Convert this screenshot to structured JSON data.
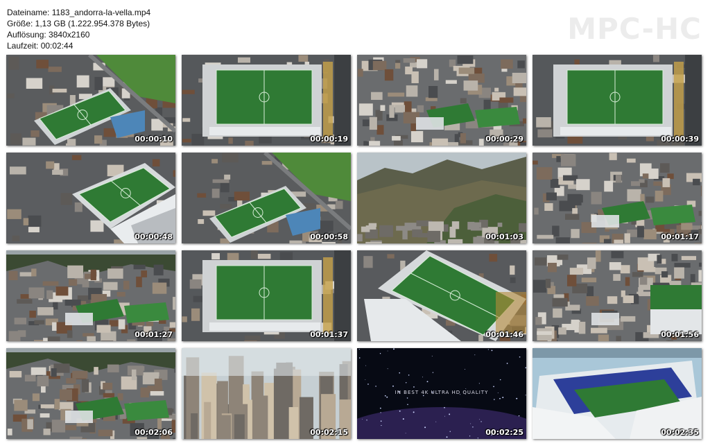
{
  "file_info": {
    "filename": "Dateiname: 1183_andorra-la-vella.mp4",
    "size": "Größe: 1,13 GB (1.222.954.378 Bytes)",
    "resolution": "Auflösung: 3840x2160",
    "duration": "Laufzeit: 00:02:44"
  },
  "logo": "MPC-HC",
  "thumbnails": [
    {
      "timestamp": "00:00:10",
      "scene": "stadium-angled"
    },
    {
      "timestamp": "00:00:19",
      "scene": "stadium-topdown"
    },
    {
      "timestamp": "00:00:29",
      "scene": "city-wide"
    },
    {
      "timestamp": "00:00:39",
      "scene": "stadium-topdown"
    },
    {
      "timestamp": "00:00:48",
      "scene": "stadium-close"
    },
    {
      "timestamp": "00:00:58",
      "scene": "stadium-angled"
    },
    {
      "timestamp": "00:01:03",
      "scene": "mountains"
    },
    {
      "timestamp": "00:01:17",
      "scene": "city-wide"
    },
    {
      "timestamp": "00:01:27",
      "scene": "city-valley"
    },
    {
      "timestamp": "00:01:37",
      "scene": "stadium-topdown"
    },
    {
      "timestamp": "00:01:46",
      "scene": "stadium-diagonal"
    },
    {
      "timestamp": "00:01:56",
      "scene": "city-dense"
    },
    {
      "timestamp": "00:02:06",
      "scene": "city-valley"
    },
    {
      "timestamp": "00:02:15",
      "scene": "skyscrapers"
    },
    {
      "timestamp": "00:02:25",
      "scene": "space-title",
      "caption": "IN BEST 4K ULTRA HD QUALITY"
    },
    {
      "timestamp": "00:02:35",
      "scene": "arena"
    }
  ],
  "colors": {
    "pitch": "#2f7a34",
    "text": "#111111",
    "logo": "#ececec"
  }
}
